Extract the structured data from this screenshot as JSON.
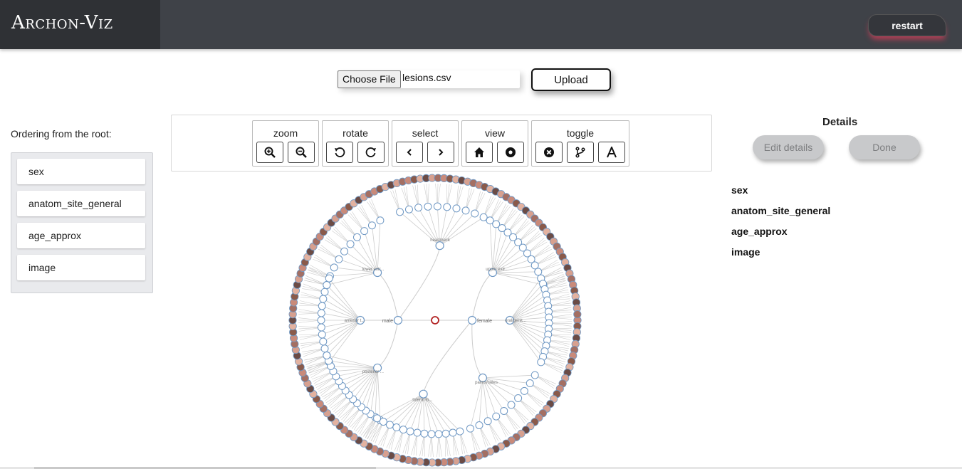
{
  "app": {
    "title": "Archon-Viz",
    "restart_label": "restart"
  },
  "upload": {
    "choose_label": "Choose File",
    "file_name": "lesions.csv",
    "upload_label": "Upload"
  },
  "ordering": {
    "title": "Ordering from the root:",
    "items": [
      "sex",
      "anatom_site_general",
      "age_approx",
      "image"
    ]
  },
  "toolbar": {
    "groups": [
      {
        "label": "zoom",
        "buttons": [
          "zoom-in-icon",
          "zoom-out-icon"
        ]
      },
      {
        "label": "rotate",
        "buttons": [
          "rotate-left-icon",
          "rotate-right-icon"
        ]
      },
      {
        "label": "select",
        "buttons": [
          "chevron-left-icon",
          "chevron-right-icon"
        ]
      },
      {
        "label": "view",
        "buttons": [
          "home-icon",
          "circle-dot-icon"
        ]
      },
      {
        "label": "toggle",
        "buttons": [
          "close-circle-icon",
          "branch-icon",
          "text-icon"
        ]
      }
    ]
  },
  "details": {
    "title": "Details",
    "edit_label": "Edit details",
    "done_label": "Done",
    "fields": [
      "sex",
      "anatom_site_general",
      "age_approx",
      "image"
    ]
  },
  "tree": {
    "root_labels": [
      "male",
      "female"
    ],
    "site_labels": [
      "lower extr...",
      "anterior t...",
      "posterior ...",
      "head/neck",
      "upper extr...",
      "oral/genit...",
      "palms/soles",
      "lateral to..."
    ]
  },
  "colors": {
    "topbar": "#3f4248",
    "brand": "#2f3135",
    "node_stroke": "#6f98c4",
    "root_stroke": "#b22222",
    "link": "#cccccc"
  }
}
